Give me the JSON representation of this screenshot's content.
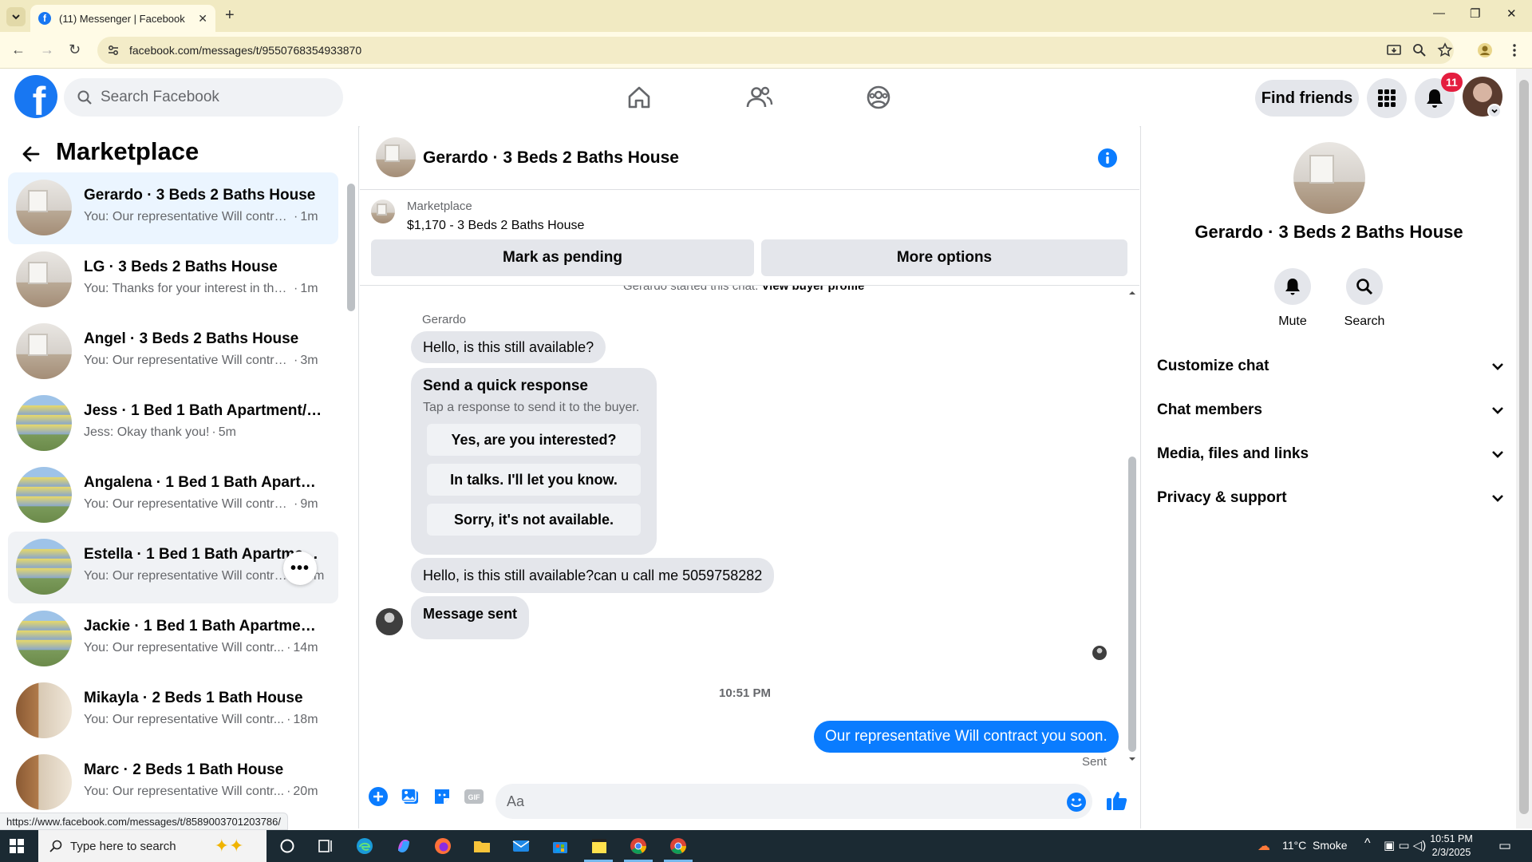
{
  "browser": {
    "tab_title": "(11) Messenger | Facebook",
    "url": "facebook.com/messages/t/9550768354933870",
    "status_url": "https://www.facebook.com/messages/t/8589003701203786/"
  },
  "header": {
    "search_placeholder": "Search Facebook",
    "find_friends": "Find friends",
    "notification_count": "11"
  },
  "sidebar": {
    "title": "Marketplace",
    "conversations": [
      {
        "name": "Gerardo · 3 Beds 2 Baths House",
        "snippet": "You: Our representative Will contra...",
        "time": "1m",
        "image": "room",
        "state": "active"
      },
      {
        "name": "LG · 3 Beds 2 Baths House",
        "snippet": "You: Thanks for your interest in the...",
        "time": "1m",
        "image": "room",
        "state": "normal"
      },
      {
        "name": "Angel · 3 Beds 2 Baths House",
        "snippet": "You: Our representative Will contra...",
        "time": "3m",
        "image": "room",
        "state": "normal"
      },
      {
        "name": "Jess · 1 Bed 1 Bath Apartment/co...",
        "snippet": "Jess: Okay thank you!",
        "time": "5m",
        "image": "apartment",
        "state": "normal"
      },
      {
        "name": "Angalena · 1 Bed 1 Bath Apartme...",
        "snippet": "You: Our representative Will contra...",
        "time": "9m",
        "image": "apartment",
        "state": "normal"
      },
      {
        "name": "Estella · 1 Bed 1 Bath Apartment/...",
        "snippet": "You: Our representative Will contra...",
        "time": "11m",
        "image": "apartment",
        "state": "hover"
      },
      {
        "name": "Jackie · 1 Bed 1 Bath Apartment/...",
        "snippet": "You: Our representative Will contr...",
        "time": "14m",
        "image": "apartment",
        "state": "normal"
      },
      {
        "name": "Mikayla · 2 Beds 1 Bath House",
        "snippet": "You: Our representative Will contr...",
        "time": "18m",
        "image": "bath",
        "state": "normal"
      },
      {
        "name": "Marc · 2 Beds 1 Bath House",
        "snippet": "You: Our representative Will contr...",
        "time": "20m",
        "image": "bath",
        "state": "normal"
      }
    ]
  },
  "chat": {
    "title": "Gerardo · 3 Beds 2 Baths House",
    "listing_label": "Marketplace",
    "listing_price": "$1,170 - 3 Beds 2 Baths House",
    "mark_pending": "Mark as pending",
    "more_options": "More options",
    "system_line": "Gerardo started this chat.",
    "system_link": "View buyer profile",
    "sender_name": "Gerardo",
    "msg1": "Hello, is this still available?",
    "quick_title": "Send a quick response",
    "quick_subtitle": "Tap a response to send it to the buyer.",
    "quick_options": [
      "Yes, are you interested?",
      "In talks. I'll let you know.",
      "Sorry, it's not available."
    ],
    "msg2": "Hello, is this still available?can u call me 5059758282",
    "msg3": "Message sent",
    "timestamp": "10:51 PM",
    "out_msg": "Our representative Will contract you soon.",
    "sent_label": "Sent",
    "input_placeholder": "Aa"
  },
  "details": {
    "name": "Gerardo · 3 Beds 2 Baths House",
    "mute": "Mute",
    "search": "Search",
    "sections": [
      "Customize chat",
      "Chat members",
      "Media, files and links",
      "Privacy & support"
    ]
  },
  "taskbar": {
    "search_placeholder": "Type here to search",
    "weather": "11°C  Smoke",
    "time": "10:51 PM",
    "date": "2/3/2025"
  },
  "colors": {
    "facebook_blue": "#1877f2",
    "outgoing_bubble": "#0a7cff",
    "active_row": "#ebf5ff",
    "badge_red": "#e41e3f"
  }
}
